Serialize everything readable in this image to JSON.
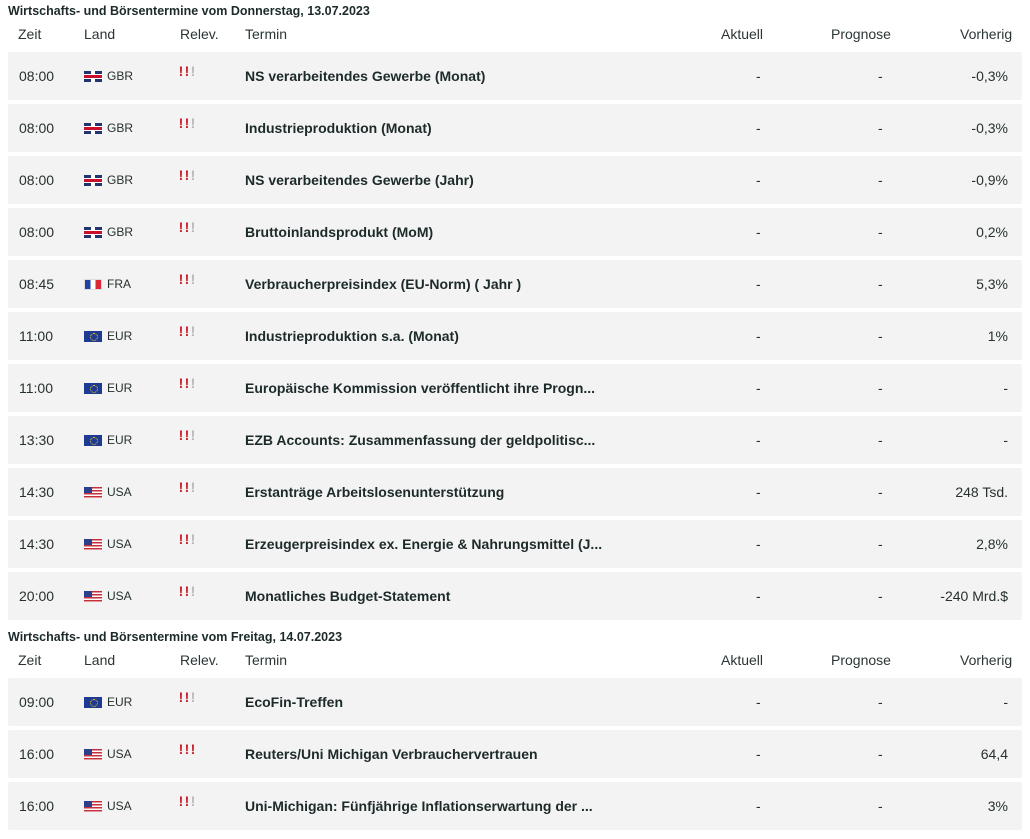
{
  "headers": {
    "zeit": "Zeit",
    "land": "Land",
    "relev": "Relev.",
    "termin": "Termin",
    "aktuell": "Aktuell",
    "prognose": "Prognose",
    "vorherig": "Vorherig"
  },
  "sections": [
    {
      "title": "Wirtschafts- und Börsentermine vom Donnerstag, 13.07.2023",
      "rows": [
        {
          "time": "08:00",
          "country": "GBR",
          "relevance": 2,
          "termin": "NS verarbeitendes Gewerbe (Monat)",
          "aktuell": "-",
          "prognose": "-",
          "vorherig": "-0,3%"
        },
        {
          "time": "08:00",
          "country": "GBR",
          "relevance": 2,
          "termin": "Industrieproduktion (Monat)",
          "aktuell": "-",
          "prognose": "-",
          "vorherig": "-0,3%"
        },
        {
          "time": "08:00",
          "country": "GBR",
          "relevance": 2,
          "termin": "NS verarbeitendes Gewerbe (Jahr)",
          "aktuell": "-",
          "prognose": "-",
          "vorherig": "-0,9%"
        },
        {
          "time": "08:00",
          "country": "GBR",
          "relevance": 2,
          "termin": "Bruttoinlandsprodukt (MoM)",
          "aktuell": "-",
          "prognose": "-",
          "vorherig": "0,2%"
        },
        {
          "time": "08:45",
          "country": "FRA",
          "relevance": 2,
          "termin": "Verbraucherpreisindex (EU-Norm) ( Jahr )",
          "aktuell": "-",
          "prognose": "-",
          "vorherig": "5,3%"
        },
        {
          "time": "11:00",
          "country": "EUR",
          "relevance": 2,
          "termin": "Industrieproduktion s.a. (Monat)",
          "aktuell": "-",
          "prognose": "-",
          "vorherig": "1%"
        },
        {
          "time": "11:00",
          "country": "EUR",
          "relevance": 2,
          "termin": "Europäische Kommission veröffentlicht ihre Progn...",
          "aktuell": "-",
          "prognose": "-",
          "vorherig": "-"
        },
        {
          "time": "13:30",
          "country": "EUR",
          "relevance": 2,
          "termin": "EZB Accounts: Zusammenfassung der geldpolitisc...",
          "aktuell": "-",
          "prognose": "-",
          "vorherig": "-"
        },
        {
          "time": "14:30",
          "country": "USA",
          "relevance": 2,
          "termin": "Erstanträge Arbeitslosenunterstützung",
          "aktuell": "-",
          "prognose": "-",
          "vorherig": "248 Tsd."
        },
        {
          "time": "14:30",
          "country": "USA",
          "relevance": 2,
          "termin": "Erzeugerpreisindex ex. Energie & Nahrungsmittel (J...",
          "aktuell": "-",
          "prognose": "-",
          "vorherig": "2,8%"
        },
        {
          "time": "20:00",
          "country": "USA",
          "relevance": 2,
          "termin": "Monatliches Budget-Statement",
          "aktuell": "-",
          "prognose": "-",
          "vorherig": "-240 Mrd.$"
        }
      ]
    },
    {
      "title": "Wirtschafts- und Börsentermine vom Freitag, 14.07.2023",
      "rows": [
        {
          "time": "09:00",
          "country": "EUR",
          "relevance": 2,
          "termin": "EcoFin-Treffen",
          "aktuell": "-",
          "prognose": "-",
          "vorherig": "-"
        },
        {
          "time": "16:00",
          "country": "USA",
          "relevance": 3,
          "termin": "Reuters/Uni Michigan Verbrauchervertrauen",
          "aktuell": "-",
          "prognose": "-",
          "vorherig": "64,4"
        },
        {
          "time": "16:00",
          "country": "USA",
          "relevance": 2,
          "termin": "Uni-Michigan: Fünfjährige Inflationserwartung der ...",
          "aktuell": "-",
          "prognose": "-",
          "vorherig": "3%"
        }
      ]
    }
  ],
  "colors": {
    "relevance_on": "#c8202c",
    "relevance_off": "#b9b9b9",
    "row_bg": "#f3f3f3"
  },
  "icons": {
    "GBR": "gbr-flag-icon",
    "FRA": "fra-flag-icon",
    "EUR": "eur-flag-icon",
    "USA": "usa-flag-icon",
    "relevance": "exclamation-mark-icon"
  }
}
